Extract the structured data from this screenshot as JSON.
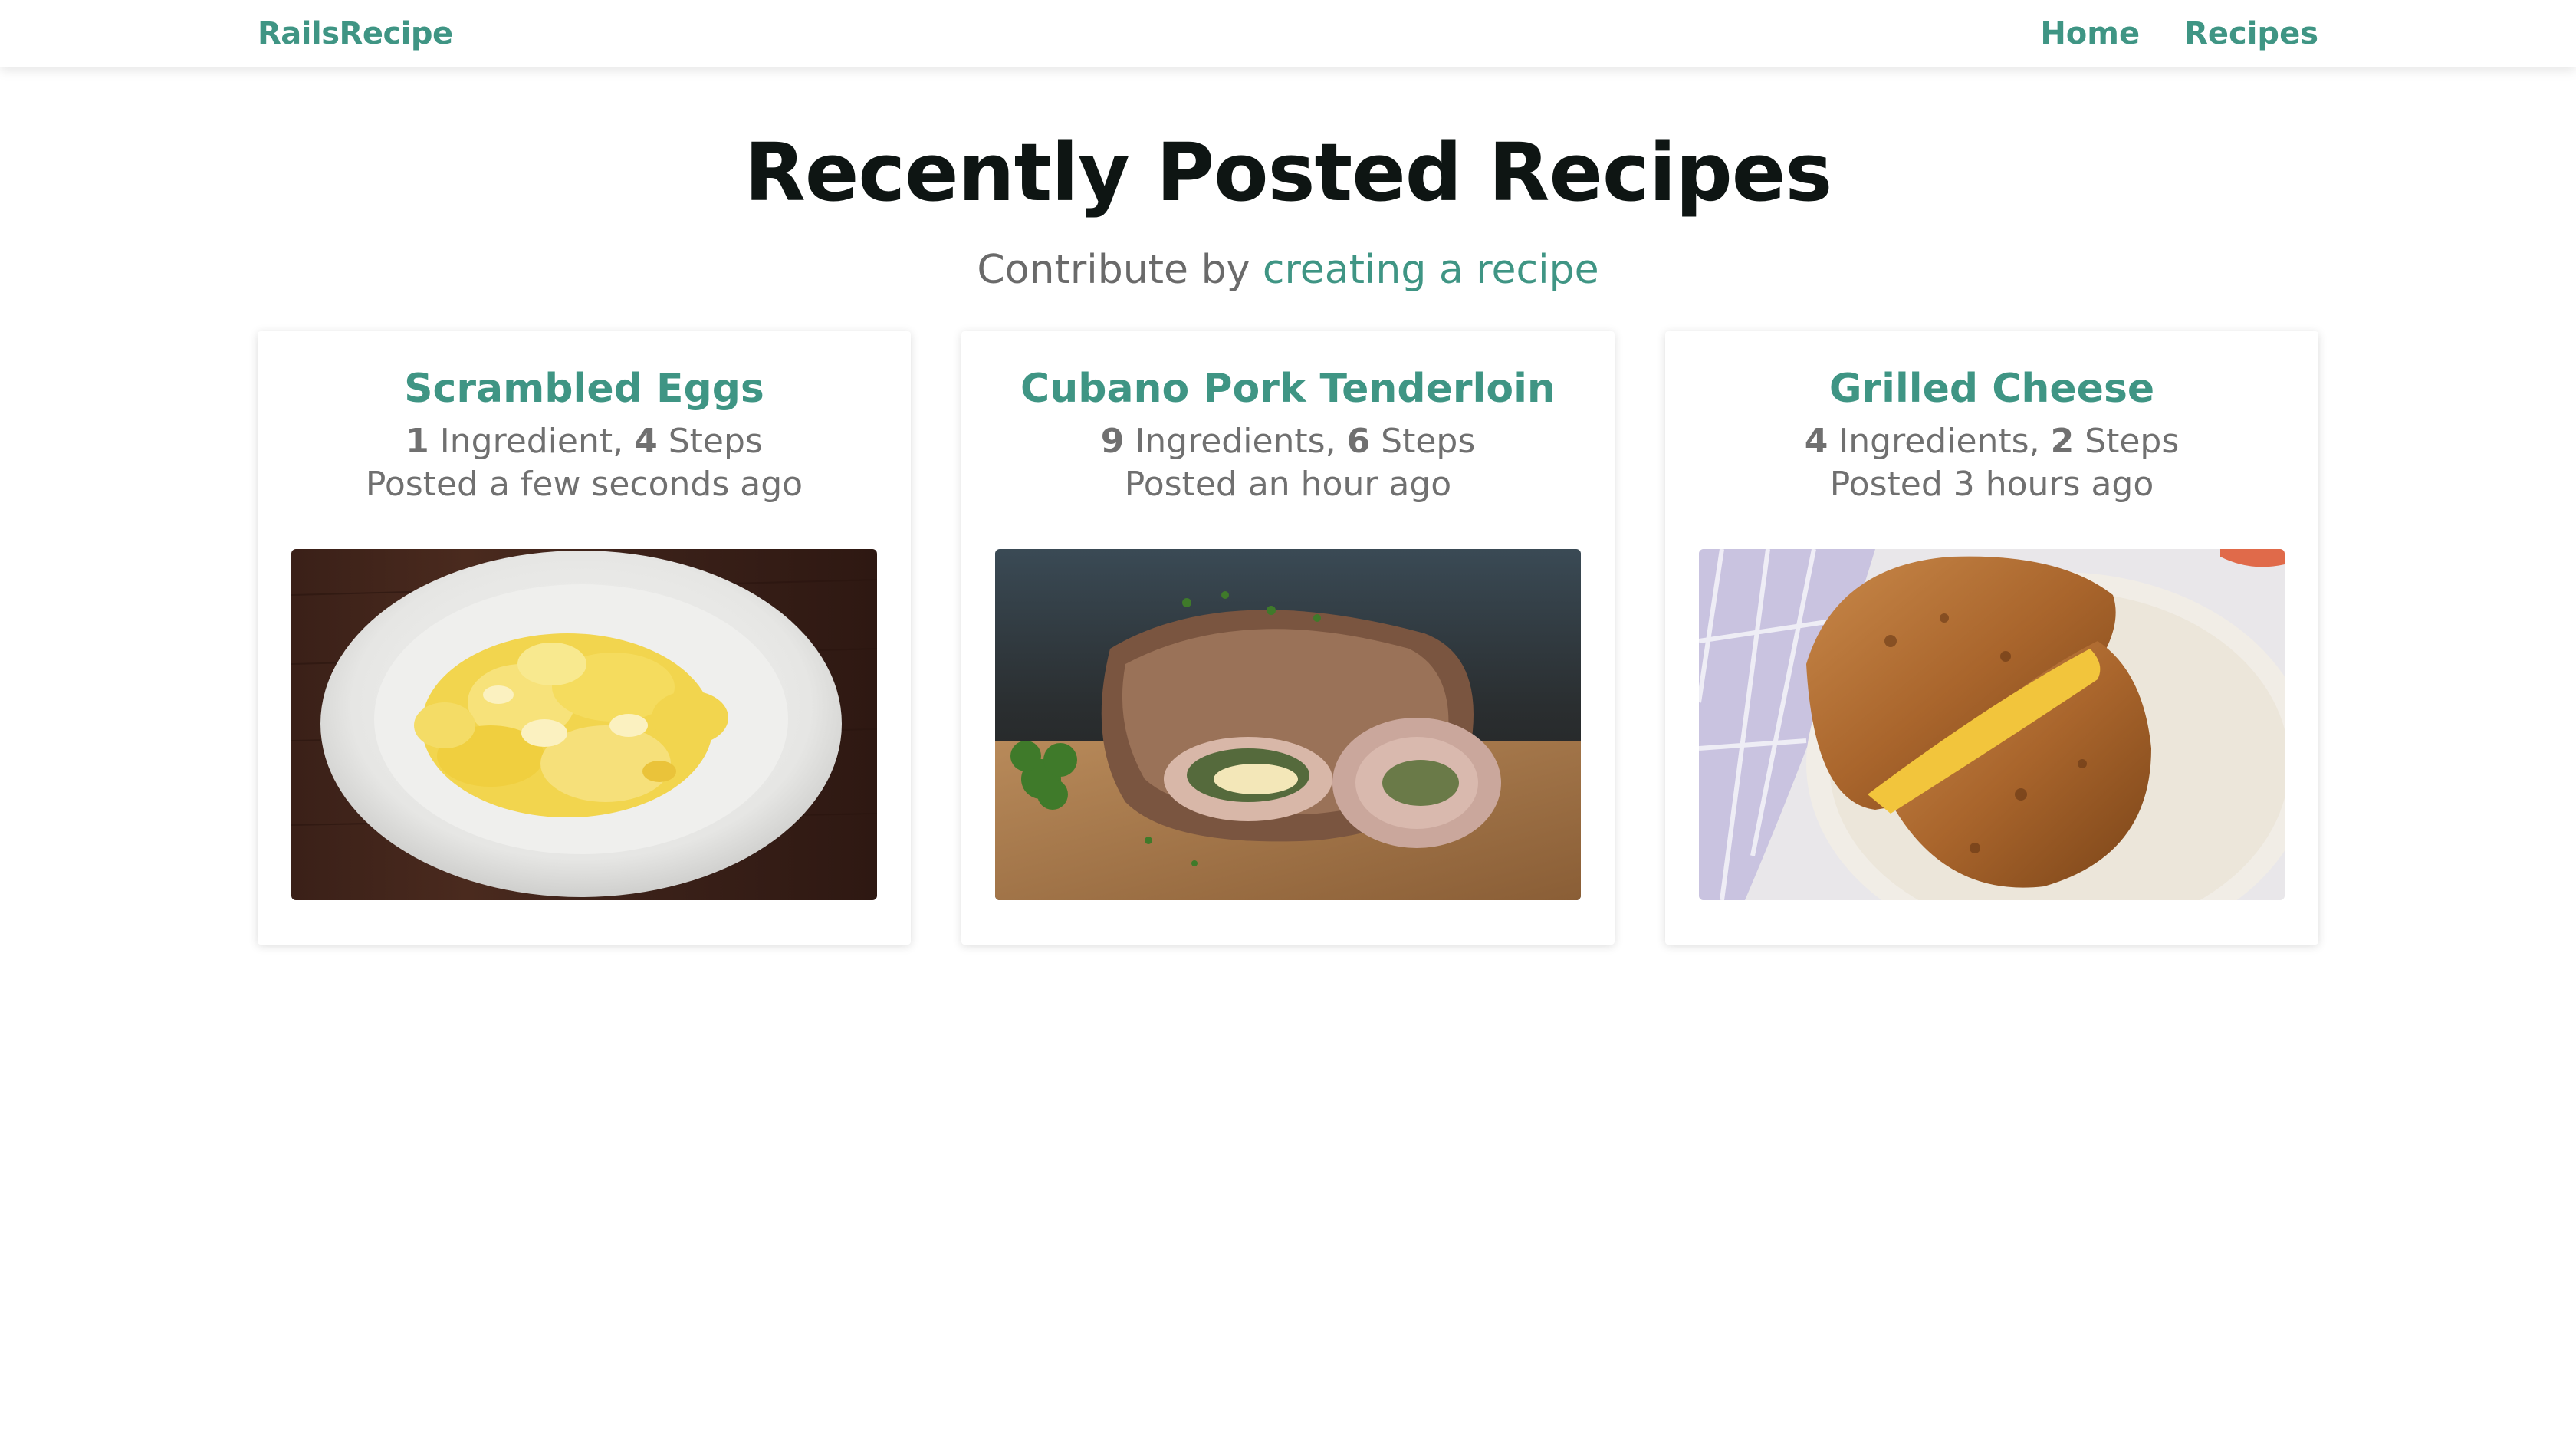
{
  "nav": {
    "brand": "RailsRecipe",
    "links": [
      {
        "label": "Home"
      },
      {
        "label": "Recipes"
      }
    ]
  },
  "header": {
    "title": "Recently Posted Recipes",
    "subtitle_prefix": "Contribute by ",
    "subtitle_link": "creating a recipe"
  },
  "recipes": [
    {
      "title": "Scrambled Eggs",
      "ingredient_count": "1",
      "ingredient_word": " Ingredient, ",
      "step_count": "4",
      "step_word": " Steps",
      "posted": "Posted a few seconds ago",
      "image_icon": "scrambled-eggs-photo"
    },
    {
      "title": "Cubano Pork Tenderloin",
      "ingredient_count": "9",
      "ingredient_word": " Ingredients, ",
      "step_count": "6",
      "step_word": " Steps",
      "posted": "Posted an hour ago",
      "image_icon": "pork-tenderloin-photo"
    },
    {
      "title": "Grilled Cheese",
      "ingredient_count": "4",
      "ingredient_word": " Ingredients, ",
      "step_count": "2",
      "step_word": " Steps",
      "posted": "Posted 3 hours ago",
      "image_icon": "grilled-cheese-photo"
    }
  ],
  "colors": {
    "accent": "#3f9584",
    "title": "#0e1513",
    "muted": "#6a6a6a"
  }
}
